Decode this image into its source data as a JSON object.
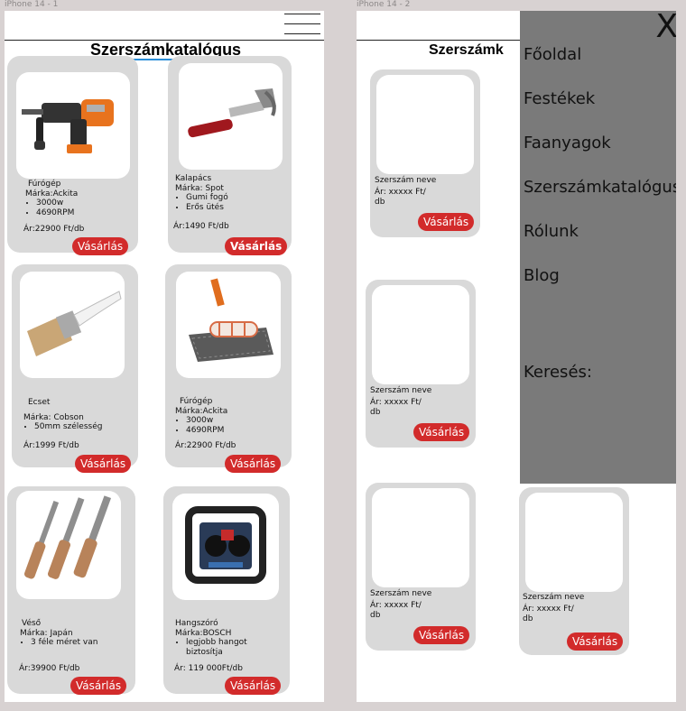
{
  "frames": [
    {
      "label": "iPhone 14 - 1",
      "title": "Szerszámkatalógus",
      "cards": [
        {
          "name": "Fúrógép",
          "brand": "Márka:Ackita",
          "features": [
            "3000w",
            "4690RPM"
          ],
          "price": "Ár:22900 Ft/db",
          "buy": "Vásárlás",
          "icon": "hammer-drill-image"
        },
        {
          "name": "Kalapács",
          "brand": "Márka: Spot",
          "features": [
            "Gumi fogó",
            "Erős ütés"
          ],
          "price": "Ár:1490 Ft/db",
          "buy": "Vásárlás",
          "icon": "hammer-image"
        },
        {
          "name": "Ecset",
          "brand": "Márka: Cobson",
          "features": [
            "50mm szélesség"
          ],
          "price": "Ár:1999 Ft/db",
          "buy": "Vásárlás",
          "icon": "paintbrush-image"
        },
        {
          "name": "Fúrógép",
          "brand": "Márka:Ackita",
          "features": [
            "3000w",
            "4690RPM"
          ],
          "price": "Ár:22900 Ft/db",
          "buy": "Vásárlás",
          "icon": "paint-roller-image"
        },
        {
          "name": "Véső",
          "brand": "Márka: Japán",
          "features": [
            "3 féle méret van"
          ],
          "price": "Ár:39900 Ft/db",
          "buy": "Vásárlás",
          "icon": "chisels-image"
        },
        {
          "name": "Hangszóró",
          "brand": "Márka:BOSCH",
          "features": [
            "legjobb hangot biztosítja"
          ],
          "price": "Ár: 119 000Ft/db",
          "buy": "Vásárlás",
          "icon": "speaker-image"
        }
      ]
    },
    {
      "label": "iPhone 14 - 2",
      "title": "Szerszámk",
      "cards": [
        {
          "name": "Szerszám neve",
          "price": "Ár: xxxxx Ft/ db",
          "buy": "Vásárlás"
        },
        {
          "name": "Szerszám neve",
          "price": "Ár: xxxxx Ft/ db",
          "buy": "Vásárlás"
        },
        {
          "name": "Szerszám neve",
          "price": "Ár: xxxxx Ft/ db",
          "buy": "Vásárlás"
        },
        {
          "name": "Szerszám neve",
          "price": "Ár: xxxxx Ft/ db",
          "buy": "Vásárlás"
        }
      ],
      "menu": {
        "close": "X",
        "items": [
          "Főoldal",
          "Festékek",
          "Faanyagok",
          "Szerszámkatalógus",
          "Rólunk",
          "Blog"
        ],
        "search_label": "Keresés:"
      }
    }
  ],
  "colors": {
    "canvas": "#d8d2d2",
    "card": "#d9d9d9",
    "buy_button": "#d22b2b",
    "menu_overlay": "#7a7a7a",
    "title_underline": "#2b8fd9"
  }
}
